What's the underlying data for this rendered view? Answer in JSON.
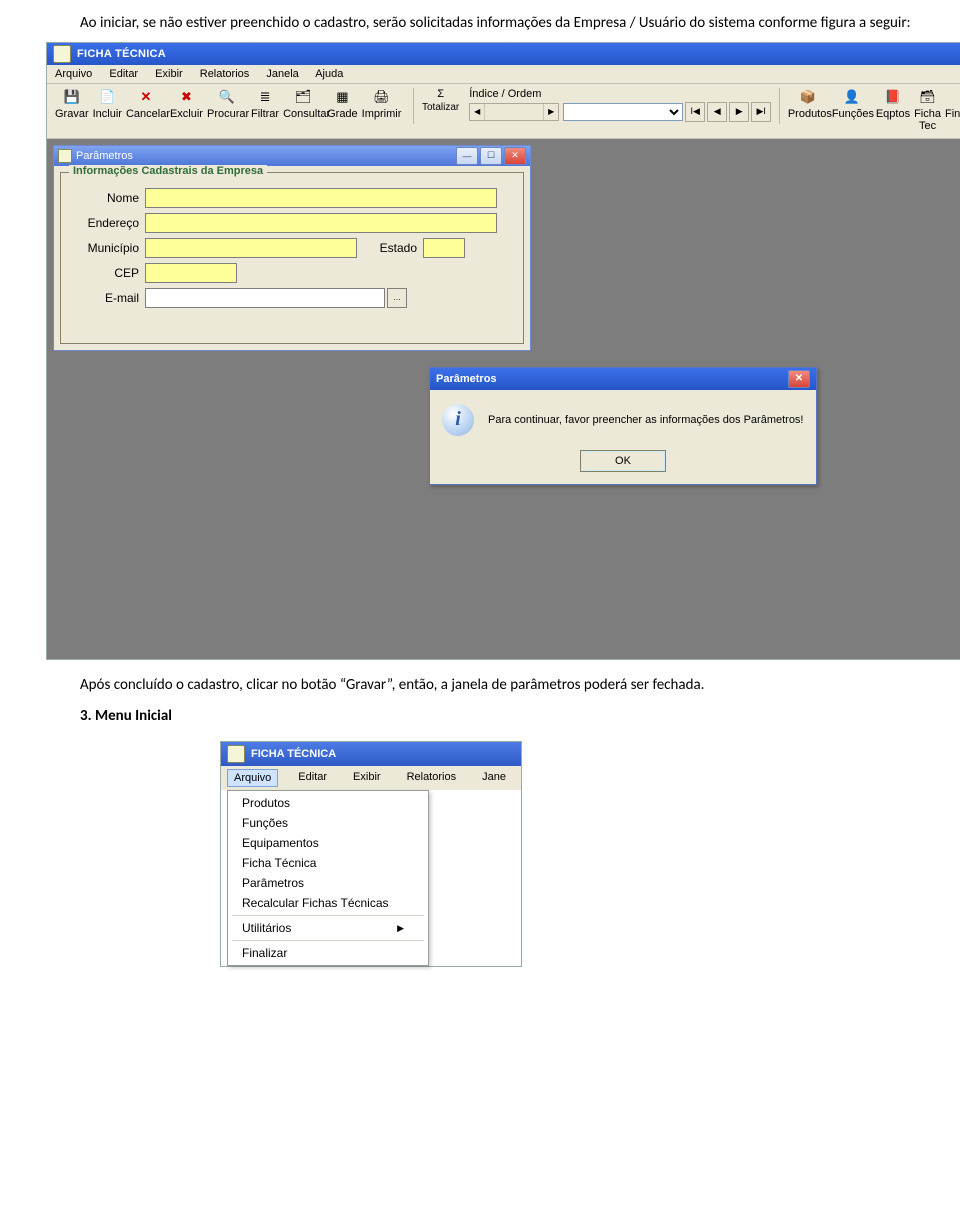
{
  "doc": {
    "para1": "Ao iniciar, se não estiver preenchido o cadastro, serão solicitadas informações da Empresa / Usuário do sistema conforme figura a seguir:",
    "para2": "Após concluído o cadastro, clicar no botão “Gravar”, então, a janela de parâmetros poderá ser fechada.",
    "section3": "3. Menu Inicial"
  },
  "app": {
    "title": "FICHA TÉCNICA",
    "menus": [
      "Arquivo",
      "Editar",
      "Exibir",
      "Relatorios",
      "Janela",
      "Ajuda"
    ],
    "toolbar": {
      "gravar": "Gravar",
      "incluir": "Incluir",
      "cancelar": "Cancelar",
      "excluir": "Excluir",
      "procurar": "Procurar",
      "filtrar": "Filtrar",
      "consultar": "Consultar",
      "grade": "Grade",
      "imprimir": "Imprimir",
      "totalizar": "Totalizar",
      "indice_label": "Índice / Ordem",
      "produtos": "Produtos",
      "funcoes": "Funções",
      "eqptos": "Eqptos",
      "fichatec": "Ficha Tec",
      "finalizar": "Finalizar"
    },
    "childwin": {
      "title": "Parâmetros",
      "legend": "Informações Cadastrais da Empresa",
      "labels": {
        "nome": "Nome",
        "endereco": "Endereço",
        "municipio": "Município",
        "estado": "Estado",
        "cep": "CEP",
        "email": "E-mail"
      }
    },
    "dialog": {
      "title": "Parâmetros",
      "message": "Para continuar, favor preencher as informações dos Parâmetros!",
      "ok": "OK"
    }
  },
  "menuapp": {
    "title": "FICHA TÉCNICA",
    "menus": [
      "Arquivo",
      "Editar",
      "Exibir",
      "Relatorios",
      "Jane"
    ],
    "items": {
      "produtos": "Produtos",
      "funcoes": "Funções",
      "equip": "Equipamentos",
      "ficha": "Ficha Técnica",
      "param": "Parâmetros",
      "recalc": "Recalcular Fichas Técnicas",
      "util": "Utilitários",
      "finalizar": "Finalizar"
    }
  }
}
